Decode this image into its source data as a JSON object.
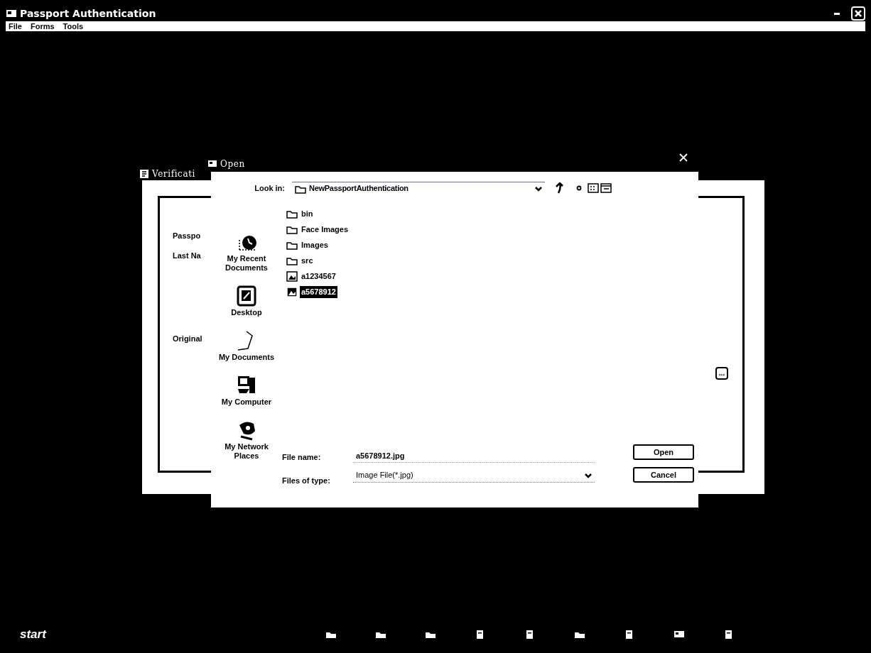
{
  "window": {
    "title": "Passport Authentication"
  },
  "menu": [
    "File",
    "Forms",
    "Tools"
  ],
  "background_window": {
    "title": "Verificati",
    "labels": [
      "Passpo",
      "Last Na",
      "Original"
    ],
    "browse_button": "..."
  },
  "dialog": {
    "title": "Open",
    "look_in_label": "Look in:",
    "look_in": "NewPassportAuthentication",
    "places": [
      {
        "label": "My Recent Documents",
        "kind": "recent"
      },
      {
        "label": "Desktop",
        "kind": "desktop"
      },
      {
        "label": "My Documents",
        "kind": "documents"
      },
      {
        "label": "My Computer",
        "kind": "computer"
      },
      {
        "label": "My Network Places",
        "kind": "network"
      }
    ],
    "files": [
      {
        "name": "bin",
        "kind": "folder",
        "selected": false
      },
      {
        "name": "Face Images",
        "kind": "folder",
        "selected": false
      },
      {
        "name": "Images",
        "kind": "folder",
        "selected": false
      },
      {
        "name": "src",
        "kind": "folder",
        "selected": false
      },
      {
        "name": "a1234567",
        "kind": "image",
        "selected": false
      },
      {
        "name": "a5678912",
        "kind": "image",
        "selected": true
      }
    ],
    "file_name_label": "File name:",
    "file_name": "a5678912.jpg",
    "file_type_label": "Files of type:",
    "file_type": "Image File(*.jpg)",
    "buttons": [
      "Open",
      "Cancel"
    ]
  },
  "taskbar": {
    "start": "start",
    "items": [
      {
        "kind": "folder"
      },
      {
        "kind": "folder"
      },
      {
        "kind": "folder"
      },
      {
        "kind": "document"
      },
      {
        "kind": "document"
      },
      {
        "kind": "folder"
      },
      {
        "kind": "document"
      },
      {
        "kind": "app"
      },
      {
        "kind": "document"
      }
    ]
  }
}
